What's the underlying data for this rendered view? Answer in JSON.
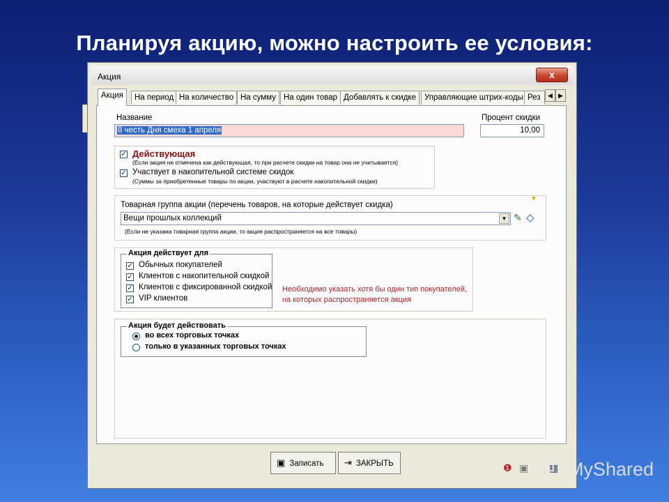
{
  "slide": {
    "title": "Планируя акцию, можно настроить ее условия:"
  },
  "dialog": {
    "title": "Акция",
    "close_label": "x",
    "tabs": [
      "Акция",
      "На период",
      "На количество",
      "На сумму",
      "На один товар",
      "Добавлять к скидке",
      "Управляющие штрих-коды",
      "Рез"
    ],
    "name_label": "Название",
    "name_value": "8 честь Дня смеха 1 апреля",
    "percent_label": "Процент скидки",
    "percent_value": "10,00",
    "active": {
      "label": "Действующая",
      "checked": true,
      "note": "(Если акция не отмечена как действующая, то при расчете скидки на товар она не учитывается)"
    },
    "accumulative": {
      "label": "Участвует в накопительной системе скидок",
      "checked": true,
      "note": "(Суммы за приобретенные товары по акции, участвуют в расчете накопительной скидки)"
    },
    "group_label": "Товарная группа акции (перечень товаров, на которые действует скидка)",
    "group_value": "Вещи прошлых коллекций",
    "group_note": "(Если не указана товарная группа акции, то акция распространяется на все товары)",
    "applies_for": {
      "legend": "Акция действует для",
      "items": [
        {
          "label": "Обычных покупателей",
          "checked": true
        },
        {
          "label": "Клиентов с накопительной скидкой",
          "checked": true
        },
        {
          "label": "Клиентов с фиксированной скидкой",
          "checked": true
        },
        {
          "label": "VIP клиентов",
          "checked": true
        }
      ],
      "warning_line1": "Необходимо указать хотя бы один тип покупателей,",
      "warning_line2": "на которых распространяется акция"
    },
    "locations": {
      "legend": "Акция будет действовать",
      "options": [
        {
          "label": "во всех торговых точках",
          "selected": true
        },
        {
          "label": "только в указанных торговых точках",
          "selected": false
        }
      ]
    },
    "buttons": {
      "save": "Записать",
      "close": "ЗАКРЫТЬ"
    }
  },
  "watermark": "MyShared"
}
